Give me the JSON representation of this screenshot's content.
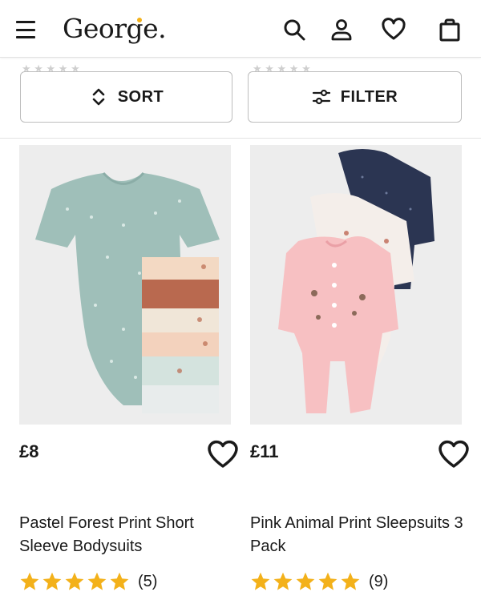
{
  "header": {
    "logo": "George.",
    "icons": [
      "menu-icon",
      "search-icon",
      "account-icon",
      "wishlist-icon",
      "basket-icon"
    ],
    "brand_dot_color": "#f3b11a"
  },
  "toolbar": {
    "sort_label": "SORT",
    "filter_label": "FILTER"
  },
  "products": [
    {
      "price": "£8",
      "title": "Pastel Forest Print Short Sleeve Bodysuits",
      "rating_count": "(5)",
      "rating": 5
    },
    {
      "price": "£11",
      "title": "Pink Animal Print Sleepsuits 3 Pack",
      "rating_count": "(9)",
      "rating": 5
    }
  ],
  "colors": {
    "star": "#f3b11a",
    "text": "#1a1a1a"
  }
}
